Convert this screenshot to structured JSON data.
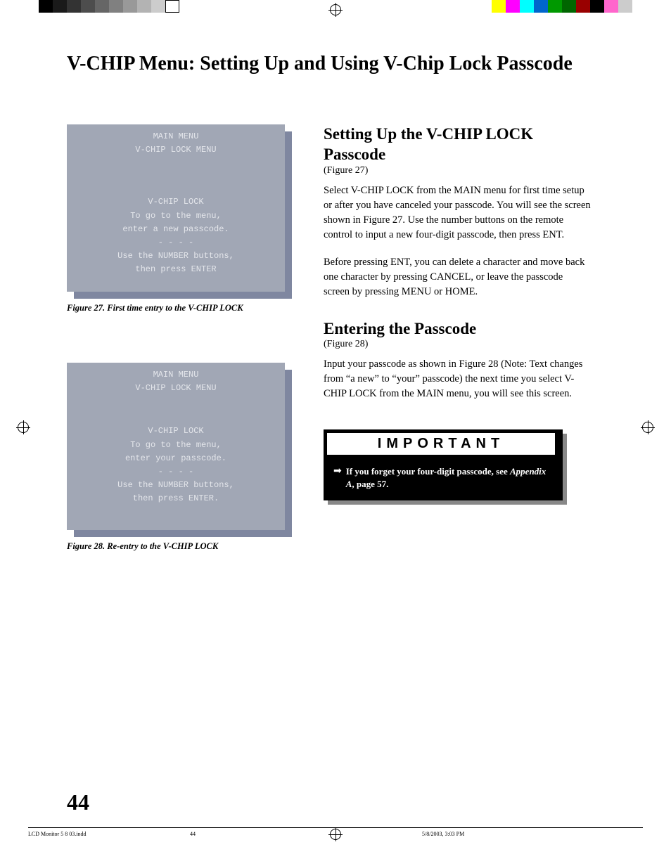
{
  "page_title": "V-CHIP Menu:  Setting Up and Using V-Chip Lock Passcode",
  "figure27": {
    "header1": "MAIN MENU",
    "header2": "V-CHIP LOCK MENU",
    "line1": "V-CHIP LOCK",
    "line2": "To go to the menu,",
    "line3": "enter a new passcode.",
    "line4": "- - - -",
    "line5": "Use the NUMBER buttons,",
    "line6": "then press ENTER",
    "caption": "Figure 27.  First time entry to the V-CHIP LOCK"
  },
  "figure28": {
    "header1": "MAIN MENU",
    "header2": "V-CHIP LOCK MENU",
    "line1": "V-CHIP LOCK",
    "line2": "To go to the menu,",
    "line3": "enter your passcode.",
    "line4": "- - - -",
    "line5": "Use the NUMBER buttons,",
    "line6": "then press ENTER.",
    "caption": "Figure 28. Re-entry to the V-CHIP LOCK"
  },
  "section1": {
    "title": "Setting Up the V-CHIP LOCK Passcode",
    "ref": "(Figure 27)",
    "p1": "Select V-CHIP LOCK from the MAIN menu for first time setup or after you have canceled your passcode. You will see the screen shown in Figure 27.  Use the number buttons on the remote control to input a new four-digit passcode, then press ENT.",
    "p2": "Before pressing ENT, you can delete a character and move back one character by pressing CANCEL, or leave the passcode screen by pressing  MENU or HOME."
  },
  "section2": {
    "title": "Entering the Passcode",
    "ref": "(Figure 28)",
    "p1": "Input your passcode as shown in Figure 28 (Note: Text changes from “a new” to “your” passcode) the next time you select V-CHIP LOCK from the MAIN menu, you will see this screen."
  },
  "important": {
    "header": "IMPORTANT",
    "arrow": "➡",
    "text_before": "If you forget your four-digit passcode, see ",
    "appendix": "Appendix A",
    "text_after": ", page 57."
  },
  "page_number": "44",
  "footer": {
    "file": "LCD Monitor 5 8 03.indd",
    "num": "44",
    "timestamp": "5/8/2003, 3:03 PM"
  }
}
